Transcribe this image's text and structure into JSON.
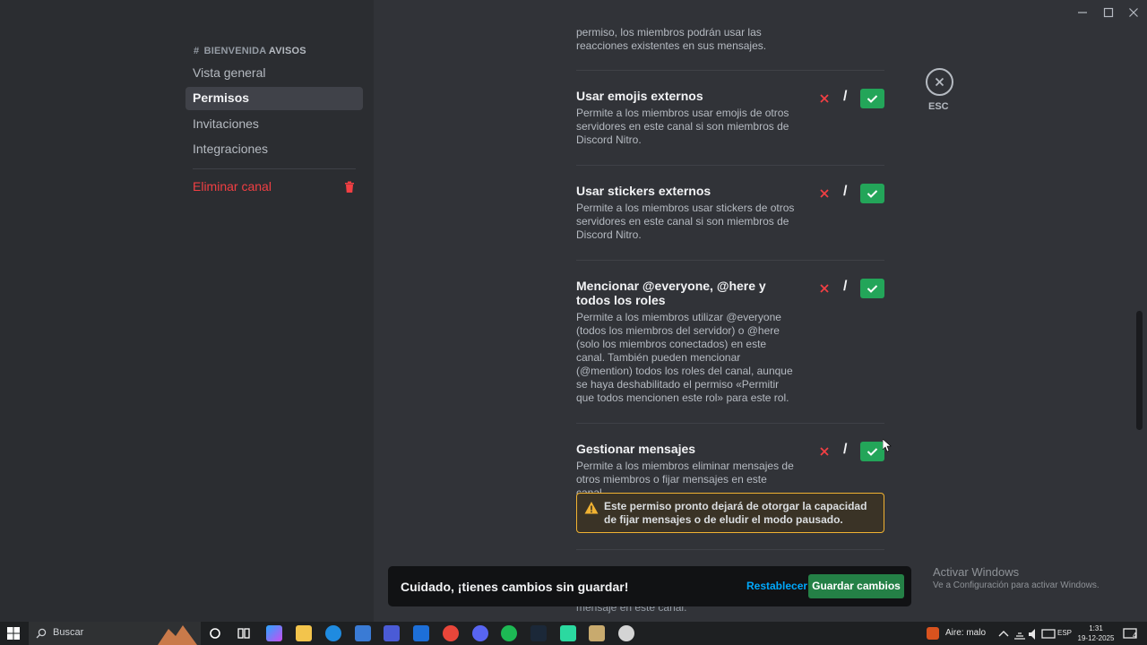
{
  "sidebar": {
    "header_hash": "#",
    "header_prefix": "BIENVENIDA",
    "header_channel": "AVISOS",
    "items": [
      {
        "label": "Vista general"
      },
      {
        "label": "Permisos"
      },
      {
        "label": "Invitaciones"
      },
      {
        "label": "Integraciones"
      }
    ],
    "delete_label": "Eliminar canal"
  },
  "permissions": {
    "top_partial_desc": "permiso, los miembros podrán usar las reacciones existentes en sus mensajes.",
    "items": [
      {
        "title": "Usar emojis externos",
        "desc": "Permite a los miembros usar emojis de otros servidores en este canal si son miembros de Discord Nitro.",
        "state": "allow"
      },
      {
        "title": "Usar stickers externos",
        "desc": "Permite a los miembros usar stickers de otros servidores en este canal si son miembros de Discord Nitro.",
        "state": "allow"
      },
      {
        "title": "Mencionar @everyone, @here y todos los roles",
        "desc": "Permite a los miembros utilizar @everyone (todos los miembros del servidor) o @here (solo los miembros conectados) en este canal. También pueden mencionar (@mention) todos los roles del canal, aunque se haya deshabilitado el permiso «Permitir que todos mencionen este rol» para este rol.",
        "state": "allow"
      },
      {
        "title": "Gestionar mensajes",
        "desc": "Permite a los miembros eliminar mensajes de otros miembros o fijar mensajes en este canal.",
        "state": "allow"
      }
    ],
    "warning": "Este permiso pronto dejará de otorgar la capacidad de fijar mensajes o de eludir el modo pausado.",
    "bottom_peek": "mensaje en este canal."
  },
  "close": {
    "label": "ESC"
  },
  "notice": {
    "text": "Cuidado, ¡tienes cambios sin guardar!",
    "reset": "Restablecer",
    "save": "Guardar cambios"
  },
  "watermark": {
    "line1": "Activar Windows",
    "line2": "Ve a Configuración para activar Windows."
  },
  "taskbar": {
    "search_placeholder": "Buscar",
    "air": "Aire: malo",
    "lang": "ESP",
    "time": "1:31",
    "date": "19-12-2025",
    "notif_count": "4"
  },
  "colors": {
    "accent_green": "#23a559",
    "danger": "#f23f43",
    "link": "#00a8fc",
    "warning": "#f0b232"
  }
}
